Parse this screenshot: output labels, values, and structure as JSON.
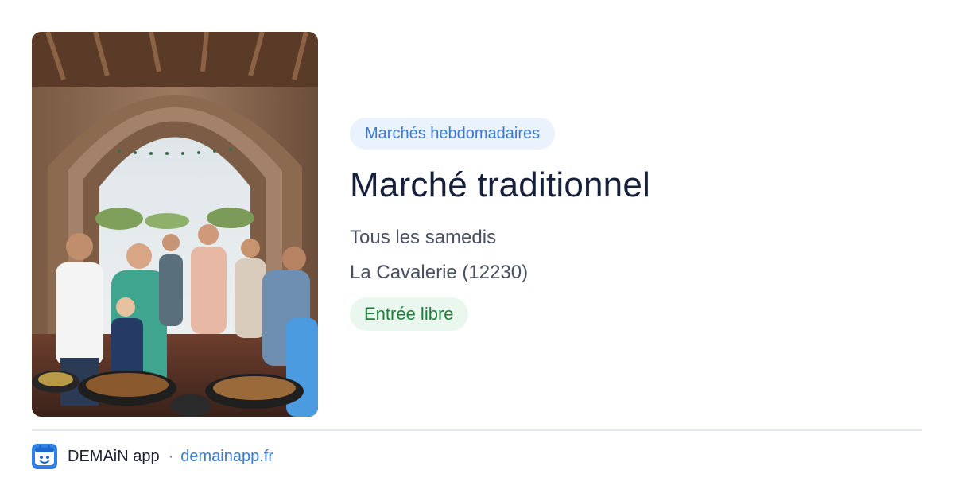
{
  "card": {
    "image_alt": "Marché couvert sous arches en pierre",
    "category": "Marchés hebdomadaires",
    "title": "Marché traditionnel",
    "schedule": "Tous les samedis",
    "location": "La Cavalerie (12230)",
    "price": "Entrée libre"
  },
  "footer": {
    "app_name": "DEMAiN app",
    "separator": "·",
    "domain": "demainapp.fr"
  },
  "colors": {
    "accent": "#3a7bd5",
    "category_bg": "#eaf2fd",
    "price_text": "#1d7f3b",
    "price_bg": "#eaf7ee",
    "title": "#16203a"
  },
  "icons": {
    "logo": "demain-app-logo-icon"
  }
}
